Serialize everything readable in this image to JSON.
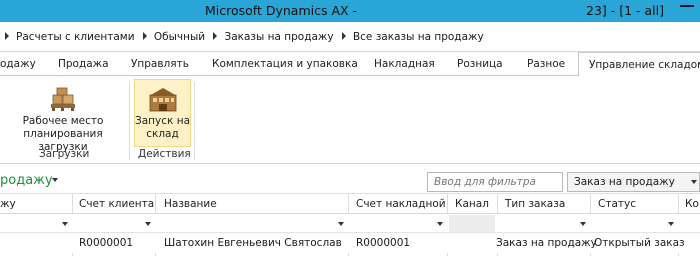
{
  "window": {
    "title": "Microsoft Dynamics AX -",
    "title_right": "23] -  [1 - all]"
  },
  "breadcrumb": {
    "items": [
      "Расчеты с клиентами",
      "Обычный",
      "Заказы на продажу",
      "Все заказы на продажу"
    ]
  },
  "ribbon_tabs": [
    "одажу",
    "Продажа",
    "Управлять",
    "Комплектация и упаковка",
    "Накладная",
    "Розница",
    "Разное",
    "Управление складом"
  ],
  "ribbon": {
    "groups": [
      {
        "label": "Загрузки",
        "buttons": [
          {
            "label_line1": "Рабочее место",
            "label_line2": "планирования загрузки",
            "icon": "pallet-boxes-icon"
          }
        ]
      },
      {
        "label": "Действия",
        "buttons": [
          {
            "label_line1": "Запуск на",
            "label_line2": "склад",
            "icon": "warehouse-icon"
          }
        ]
      }
    ]
  },
  "grid": {
    "title": "родажу",
    "filter_placeholder": "Ввод для фильтра",
    "filter_field": "Заказ на продажу",
    "columns": [
      "жу",
      "Счет клиента",
      "Название",
      "Счет накладной",
      "Канал",
      "Тип заказа",
      "Статус",
      "Ко"
    ],
    "rows": [
      {
        "sales_order": "",
        "customer_account": "R0000001",
        "name": "Шатохин Евгеньевич Святослав",
        "invoice_account": "R0000001",
        "channel": "",
        "order_type": "Заказ на продажу",
        "status": "Открытый заказ",
        "extra": ""
      }
    ]
  },
  "colors": {
    "titlebar": "#2aa5d8",
    "grid_title": "#1e8f3b",
    "selected_button": "#fff1c6"
  }
}
